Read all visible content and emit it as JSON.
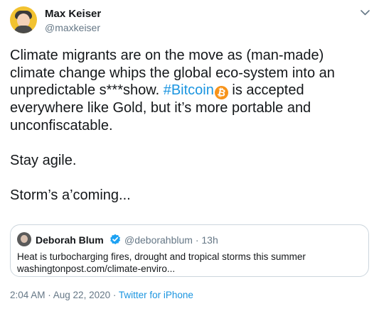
{
  "author": {
    "name": "Max Keiser",
    "handle": "@maxkeiser"
  },
  "tweet": {
    "line1": "Climate migrants are on the move as (man-made)",
    "line2": "climate change whips the global eco-system into an",
    "line3_before": "unpredictable s***show. ",
    "hashtag": "#Bitcoin",
    "btc_symbol": "₿",
    "line3_after": " is accepted",
    "line4": "everywhere like Gold, but it’s more portable and",
    "line5": "unconfiscatable.",
    "paragraph2": "Stay agile.",
    "paragraph3": "Storm’s a’coming..."
  },
  "quoted_tweet": {
    "name": "Deborah Blum",
    "handle_time": "@deborahblum · 13h",
    "text": "Heat is turbocharging fires, drought and tropical storms this summer",
    "link": "washingtonpost.com/climate-enviro..."
  },
  "meta": {
    "timestamp": "2:04 AM · Aug 22, 2020 · ",
    "source": "Twitter for iPhone"
  },
  "colors": {
    "link": "#1b95e0",
    "secondary_text": "#657786",
    "bitcoin": "#f7931a",
    "verified": "#1da1f2",
    "border": "#ccd6dd"
  },
  "icons": {
    "caret": "chevron-down-icon",
    "verified": "verified-badge-icon",
    "bitcoin": "bitcoin-icon"
  }
}
